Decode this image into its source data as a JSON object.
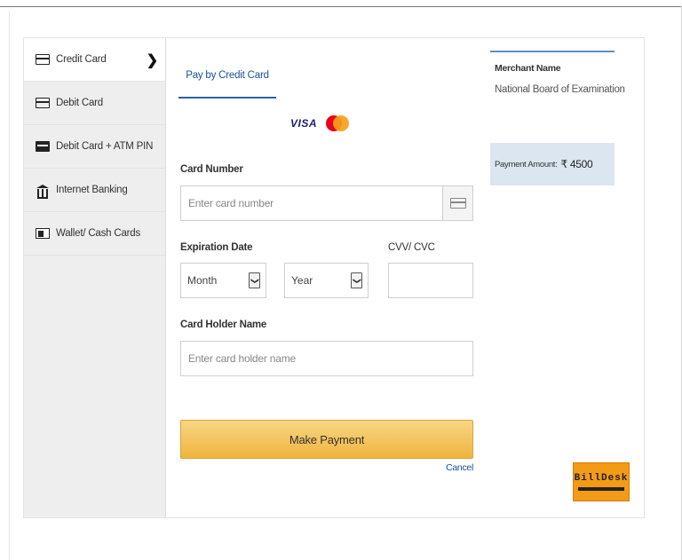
{
  "sidebar": {
    "items": [
      {
        "label": "Credit Card",
        "icon": "credit-card-icon",
        "active": true
      },
      {
        "label": "Debit Card",
        "icon": "debit-card-icon",
        "active": false
      },
      {
        "label": "Debit Card + ATM PIN",
        "icon": "atm-card-icon",
        "active": false
      },
      {
        "label": "Internet Banking",
        "icon": "bank-icon",
        "active": false
      },
      {
        "label": "Wallet/ Cash Cards",
        "icon": "wallet-icon",
        "active": false
      }
    ],
    "chevron": "❯"
  },
  "tab": {
    "label": "Pay by Credit Card"
  },
  "card_logos": {
    "visa": "VISA"
  },
  "form": {
    "card_number": {
      "label": "Card Number",
      "placeholder": "Enter card number"
    },
    "expiration": {
      "label": "Expiration Date",
      "month": "Month",
      "year": "Year",
      "arrow": "❯"
    },
    "cvv": {
      "label": "CVV/ CVC",
      "value": ""
    },
    "holder": {
      "label": "Card Holder Name",
      "placeholder": "Enter card holder name"
    },
    "submit_label": "Make Payment",
    "cancel_label": "Cancel"
  },
  "merchant": {
    "label": "Merchant Name",
    "name": "National Board of Examination",
    "amount_label": "Payment Amount:",
    "amount": "₹ 4500"
  },
  "branding": {
    "billdesk": "BillDesk"
  },
  "colors": {
    "accent": "#2d5fa8",
    "button": "#f0b43e",
    "amount_band": "#dbe6f1",
    "sidebar": "#eeeeee",
    "billdesk": "#f39a16"
  }
}
